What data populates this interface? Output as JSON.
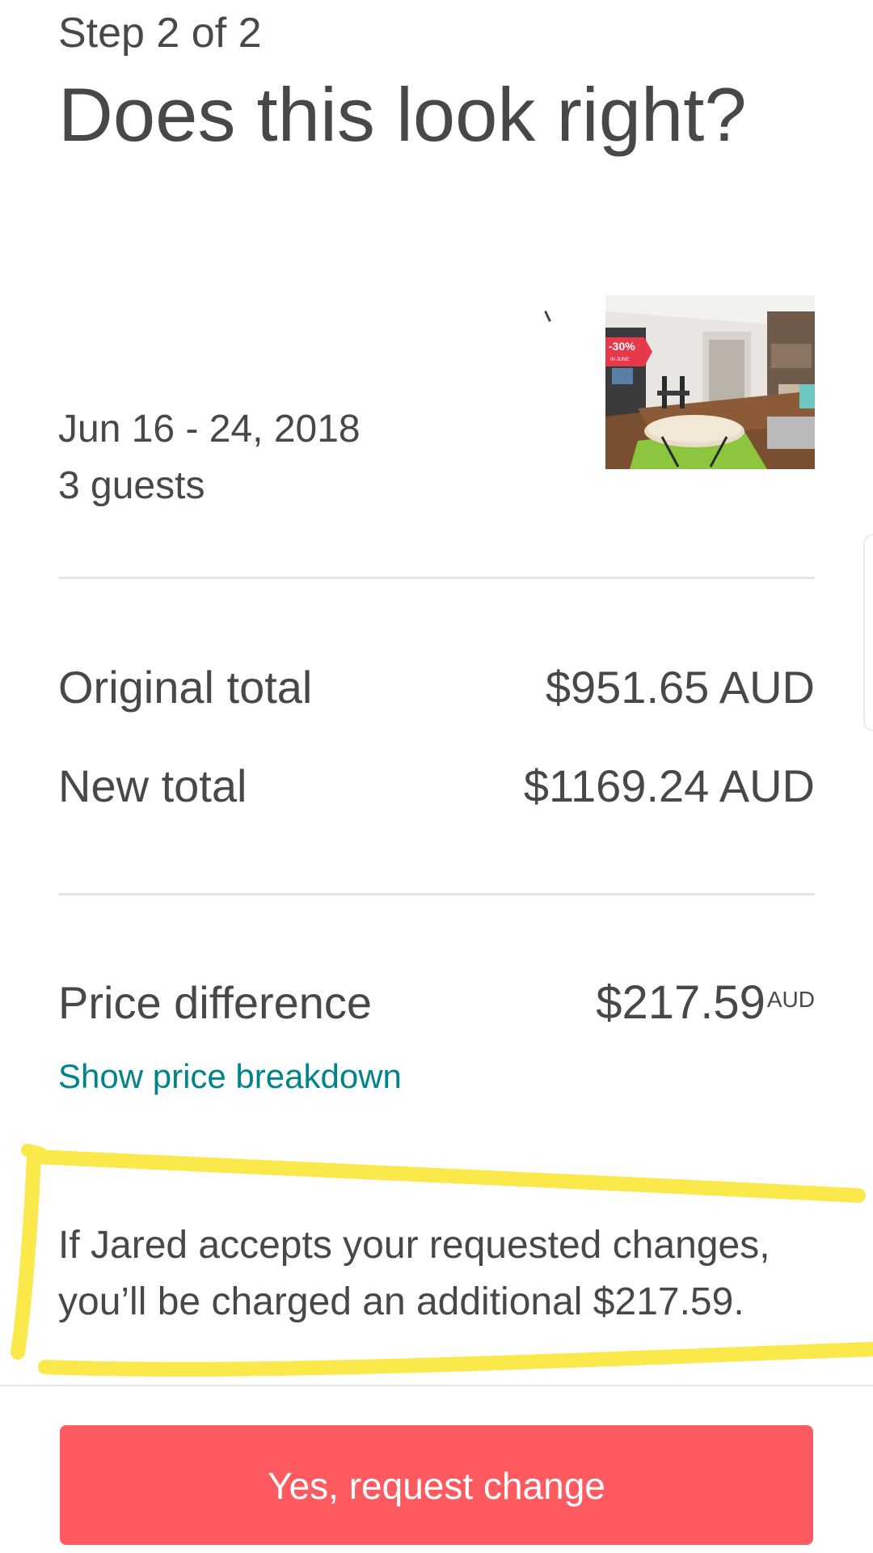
{
  "header": {
    "step": "Step 2 of 2",
    "title": "Does this look right?"
  },
  "trip": {
    "dates": "Jun 16 - 24, 2018",
    "guests": "3 guests",
    "photo_badge": "-30%",
    "photo_badge_sub": "IN JUNE"
  },
  "totals": {
    "original_label": "Original total",
    "original_value": "$951.65 AUD",
    "new_label": "New total",
    "new_value": "$1169.24 AUD"
  },
  "difference": {
    "label": "Price difference",
    "amount": "$217.59",
    "currency": "AUD",
    "breakdown_link": "Show price breakdown"
  },
  "notice": {
    "line1": "If Jared accepts your requested changes,",
    "line2": "you’ll be charged an additional $217.59."
  },
  "footer": {
    "button_label": "Yes, request change"
  },
  "colors": {
    "text": "#484848",
    "link": "#008489",
    "button": "#ff5a5f",
    "highlight": "#fbe84a",
    "divider": "#e4e4e4"
  }
}
